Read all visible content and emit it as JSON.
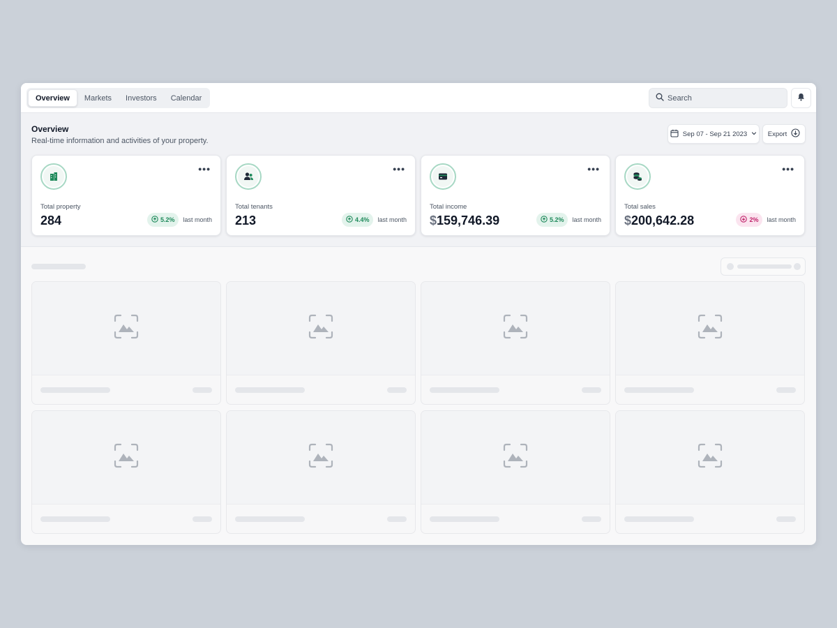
{
  "nav": {
    "tabs": [
      {
        "label": "Overview",
        "active": true
      },
      {
        "label": "Markets",
        "active": false
      },
      {
        "label": "Investors",
        "active": false
      },
      {
        "label": "Calendar",
        "active": false
      }
    ],
    "search_placeholder": "Search"
  },
  "header": {
    "title": "Overview",
    "subtitle": "Real-time information and activities of your property.",
    "date_range": "Sep 07 - Sep 21 2023",
    "export_label": "Export"
  },
  "stats": [
    {
      "label": "Total property",
      "currency": "",
      "value": "284",
      "change": "5.2%",
      "trend": "up",
      "period": "last month",
      "icon": "building-icon"
    },
    {
      "label": "Total tenants",
      "currency": "",
      "value": "213",
      "change": "4.4%",
      "trend": "up",
      "period": "last month",
      "icon": "users-icon"
    },
    {
      "label": "Total income",
      "currency": "$",
      "value": "159,746.39",
      "change": "5.2%",
      "trend": "up",
      "period": "last month",
      "icon": "credit-card-icon"
    },
    {
      "label": "Total sales",
      "currency": "$",
      "value": "200,642.28",
      "change": "2%",
      "trend": "down",
      "period": "last month",
      "icon": "coins-icon"
    }
  ],
  "colors": {
    "accent_green": "#1f8a5b",
    "positive_bg": "#e3f3ec",
    "negative": "#c0246b",
    "negative_bg": "#fbe4ef"
  },
  "placeholder_cards": 8
}
